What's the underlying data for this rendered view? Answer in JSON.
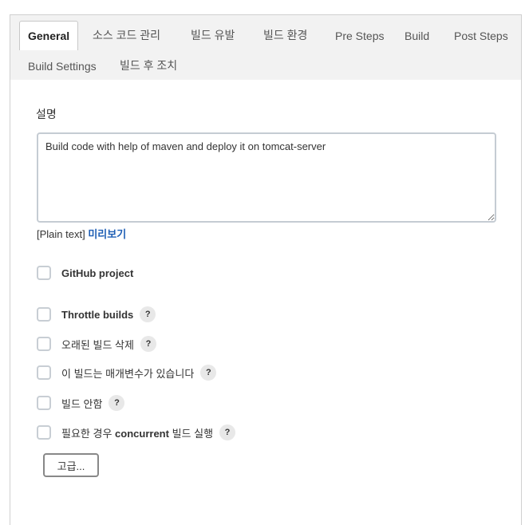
{
  "tabs": [
    {
      "label": "General"
    },
    {
      "label": "소스 코드 관리"
    },
    {
      "label": "빌드 유발"
    },
    {
      "label": "빌드 환경"
    },
    {
      "label": "Pre Steps"
    },
    {
      "label": "Build"
    },
    {
      "label": "Post Steps"
    },
    {
      "label": "Build Settings"
    },
    {
      "label": "빌드 후 조치"
    }
  ],
  "description": {
    "label": "설명",
    "value": "Build code with help of maven and deploy it on tomcat-server",
    "format_note": "[Plain text]",
    "preview_link": "미리보기"
  },
  "options": {
    "github_project": "GitHub project",
    "throttle_builds": "Throttle builds",
    "discard_old_builds": "오래된 빌드 삭제",
    "parameterized": "이 빌드는 매개변수가 있습니다",
    "disable_build": "빌드 안함",
    "concurrent_prefix": "필요한 경우",
    "concurrent_word": "concurrent",
    "concurrent_suffix": "빌드 실행",
    "help_glyph": "?"
  },
  "advanced_button": "고급..."
}
